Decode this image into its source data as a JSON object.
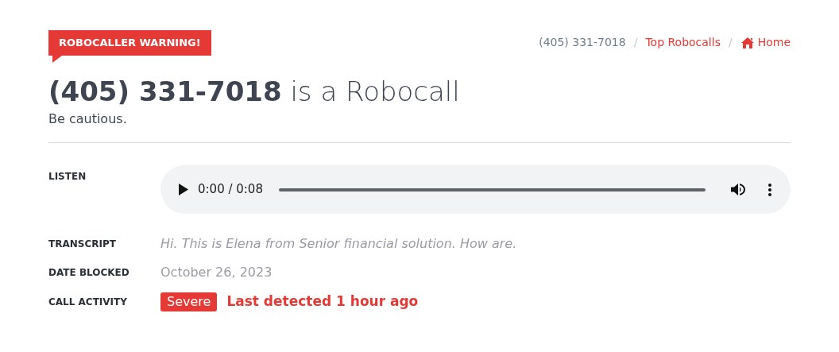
{
  "badge": "ROBOCALLER WARNING!",
  "breadcrumb": [
    {
      "label": "(405) 331-7018",
      "kind": "current"
    },
    {
      "label": "/",
      "kind": "separator"
    },
    {
      "label": "Top Robocalls",
      "kind": "link"
    },
    {
      "label": "/",
      "kind": "separator"
    },
    {
      "label": "Home",
      "kind": "home"
    }
  ],
  "heading": {
    "number": "(405) 331-7018",
    "rest": "is a Robocall"
  },
  "subtitle": "Be cautious.",
  "details": [
    {
      "label": "LISTEN",
      "kind": "audio",
      "time": "0:00 / 0:08"
    },
    {
      "label": "TRANSCRIPT",
      "kind": "transcript",
      "value": "Hi. This is Elena from Senior financial solution. How are."
    },
    {
      "label": "DATE BLOCKED",
      "kind": "date",
      "value": "October 26, 2023"
    },
    {
      "label": "CALL ACTIVITY",
      "kind": "activity",
      "tag": "Severe",
      "color": "#e53935",
      "value": "Last detected 1 hour ago"
    }
  ]
}
